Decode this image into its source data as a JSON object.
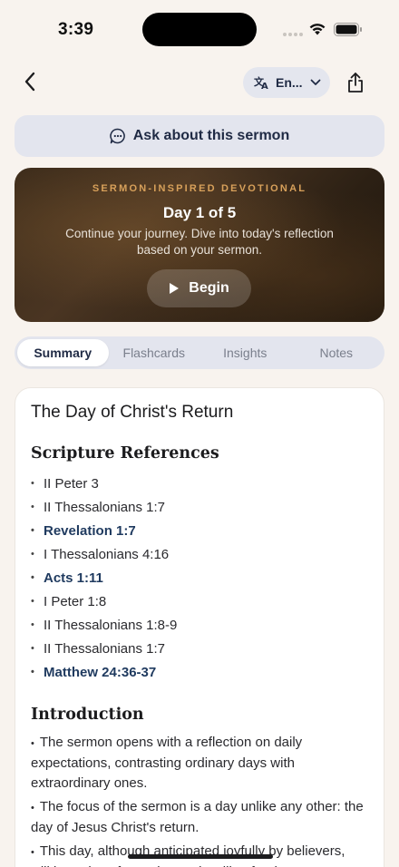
{
  "status_bar": {
    "time": "3:39"
  },
  "nav": {
    "language_label": "En..."
  },
  "ask_button": {
    "label": "Ask about this sermon"
  },
  "devotional": {
    "eyebrow": "SERMON-INSPIRED DEVOTIONAL",
    "day": "Day 1 of 5",
    "description": "Continue your journey. Dive into today's reflection based on your sermon.",
    "button_label": "Begin"
  },
  "tabs": [
    {
      "label": "Summary",
      "active": true
    },
    {
      "label": "Flashcards",
      "active": false
    },
    {
      "label": "Insights",
      "active": false
    },
    {
      "label": "Notes",
      "active": false
    }
  ],
  "content": {
    "title": "The Day of Christ's Return",
    "scripture_heading": "Scripture References",
    "references": [
      {
        "text": "II Peter 3",
        "link": false
      },
      {
        "text": "II Thessalonians 1:7",
        "link": false
      },
      {
        "text": "Revelation 1:7",
        "link": true
      },
      {
        "text": "I Thessalonians 4:16",
        "link": false
      },
      {
        "text": "Acts 1:11",
        "link": true
      },
      {
        "text": "I Peter 1:8",
        "link": false
      },
      {
        "text": "II Thessalonians 1:8-9",
        "link": false
      },
      {
        "text": "II Thessalonians 1:7",
        "link": false
      },
      {
        "text": "Matthew 24:36-37",
        "link": true
      }
    ],
    "introduction_heading": "Introduction",
    "introduction": [
      "The sermon opens with a reflection on daily expectations, contrasting ordinary days with extraordinary ones.",
      "The focus of the sermon is a day unlike any other: the day of Jesus Christ's return.",
      "This day, although anticipated joyfully by believers, will be a day of weeping and wailing for those unprepared."
    ]
  },
  "colors": {
    "background": "#f8f3ee",
    "accent_navy": "#1f3a5f",
    "eyebrow_gold": "#d7a05a"
  }
}
